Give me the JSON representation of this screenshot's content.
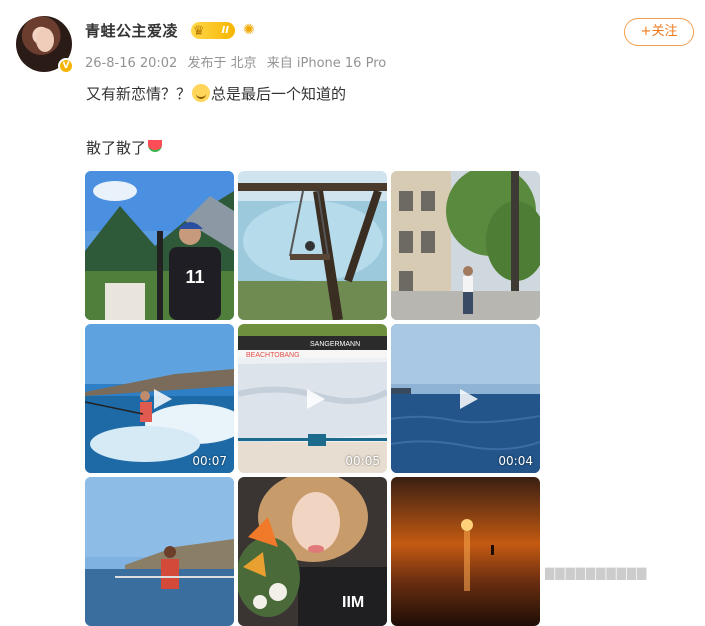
{
  "user": {
    "name": "青蛙公主爱凌",
    "level_badge": "II",
    "avatar_badge": "V"
  },
  "meta": {
    "time": "26-8-16 20:02",
    "location": "发布于 北京",
    "device": "来自 iPhone 16 Pro"
  },
  "follow_button": "+关注",
  "post": {
    "line1_a": "又有新恋情？？",
    "line1_b": "总是最后一个知道的",
    "line2": "散了散了"
  },
  "media": [
    {
      "name": "photo-mountains",
      "type": "photo",
      "shirt_number": "11"
    },
    {
      "name": "photo-swing",
      "type": "photo"
    },
    {
      "name": "photo-street",
      "type": "photo"
    },
    {
      "name": "video-wakesurf",
      "type": "video",
      "duration": "00:07"
    },
    {
      "name": "video-snow-slope",
      "type": "video",
      "duration": "00:05",
      "sign_text": "SANGERMANN",
      "banner_text": "BEACHTOBANG"
    },
    {
      "name": "video-sea",
      "type": "video",
      "duration": "00:04"
    },
    {
      "name": "photo-boat",
      "type": "photo"
    },
    {
      "name": "photo-flowers-selfie",
      "type": "photo",
      "shirt_text": "IIM"
    },
    {
      "name": "photo-sunset",
      "type": "photo"
    }
  ],
  "colors": {
    "accent": "#ee7a1e",
    "meta_gray": "#939393",
    "text": "#333333"
  }
}
